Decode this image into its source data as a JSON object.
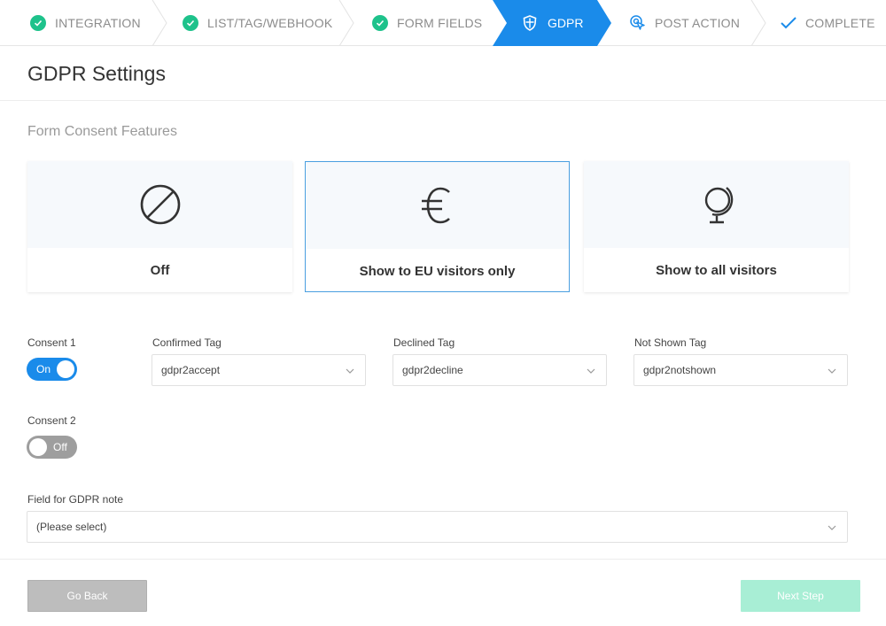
{
  "stepper": {
    "steps": [
      {
        "label": "INTEGRATION",
        "status": "done"
      },
      {
        "label": "LIST/TAG/WEBHOOK",
        "status": "done"
      },
      {
        "label": "FORM FIELDS",
        "status": "done"
      },
      {
        "label": "GDPR",
        "status": "active"
      },
      {
        "label": "POST ACTION",
        "status": "pending"
      },
      {
        "label": "COMPLETE",
        "status": "pending"
      }
    ],
    "colors": {
      "done": "#1ec28b",
      "active": "#1a8bea",
      "pending": "#1a8bea"
    }
  },
  "page": {
    "title": "GDPR Settings",
    "section_title": "Form Consent Features"
  },
  "consent_options": [
    {
      "label": "Off",
      "icon": "prohibited-icon",
      "selected": false
    },
    {
      "label": "Show to EU visitors only",
      "icon": "euro-icon",
      "selected": true
    },
    {
      "label": "Show to all visitors",
      "icon": "globe-icon",
      "selected": false
    }
  ],
  "consent1": {
    "label": "Consent 1",
    "toggle_text": "On",
    "enabled": true,
    "confirmed_tag": {
      "label": "Confirmed Tag",
      "value": "gdpr2accept"
    },
    "declined_tag": {
      "label": "Declined Tag",
      "value": "gdpr2decline"
    },
    "not_shown_tag": {
      "label": "Not Shown Tag",
      "value": "gdpr2notshown"
    }
  },
  "consent2": {
    "label": "Consent 2",
    "toggle_text": "Off",
    "enabled": false
  },
  "gdpr_note": {
    "label": "Field for GDPR note",
    "value": "(Please select)"
  },
  "footer": {
    "back_label": "Go Back",
    "next_label": "Next Step"
  }
}
